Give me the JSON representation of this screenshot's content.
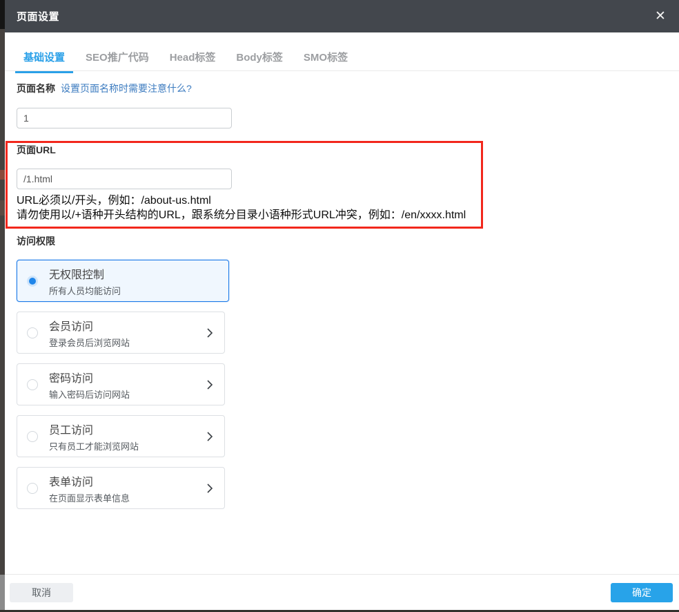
{
  "dialog": {
    "title": "页面设置",
    "close_icon": "✕"
  },
  "tabs": [
    {
      "label": "基础设置",
      "active": true
    },
    {
      "label": "SEO推广代码",
      "active": false
    },
    {
      "label": "Head标签",
      "active": false
    },
    {
      "label": "Body标签",
      "active": false
    },
    {
      "label": "SMO标签",
      "active": false
    }
  ],
  "page_name": {
    "label": "页面名称",
    "help_link": "设置页面名称时需要注意什么?",
    "value": "1"
  },
  "page_url": {
    "label": "页面URL",
    "value": "/1.html",
    "hint_line1": "URL必须以/开头，例如：/about-us.html",
    "hint_line2": "请勿使用以/+语种开头结构的URL，跟系统分目录小语种形式URL冲突，例如：/en/xxxx.html"
  },
  "access": {
    "label": "访问权限",
    "options": [
      {
        "title": "无权限控制",
        "subtitle": "所有人员均能访问",
        "selected": true
      },
      {
        "title": "会员访问",
        "subtitle": "登录会员后浏览网站",
        "selected": false
      },
      {
        "title": "密码访问",
        "subtitle": "输入密码后访问网站",
        "selected": false
      },
      {
        "title": "员工访问",
        "subtitle": "只有员工才能浏览网站",
        "selected": false
      },
      {
        "title": "表单访问",
        "subtitle": "在页面显示表单信息",
        "selected": false
      }
    ]
  },
  "footer": {
    "cancel_label": "取消",
    "confirm_label": "确定"
  },
  "colors": {
    "header_bg": "#43474d",
    "accent_tab_blue": "#2aa0e8",
    "selected_card_border": "#1a79e8",
    "selected_card_bg": "#f0f7fe",
    "radio_fill": "#1f86ea",
    "annotation_red": "#f2271c",
    "confirm_button": "#28a3e9",
    "link_blue": "#3d7cc0"
  }
}
